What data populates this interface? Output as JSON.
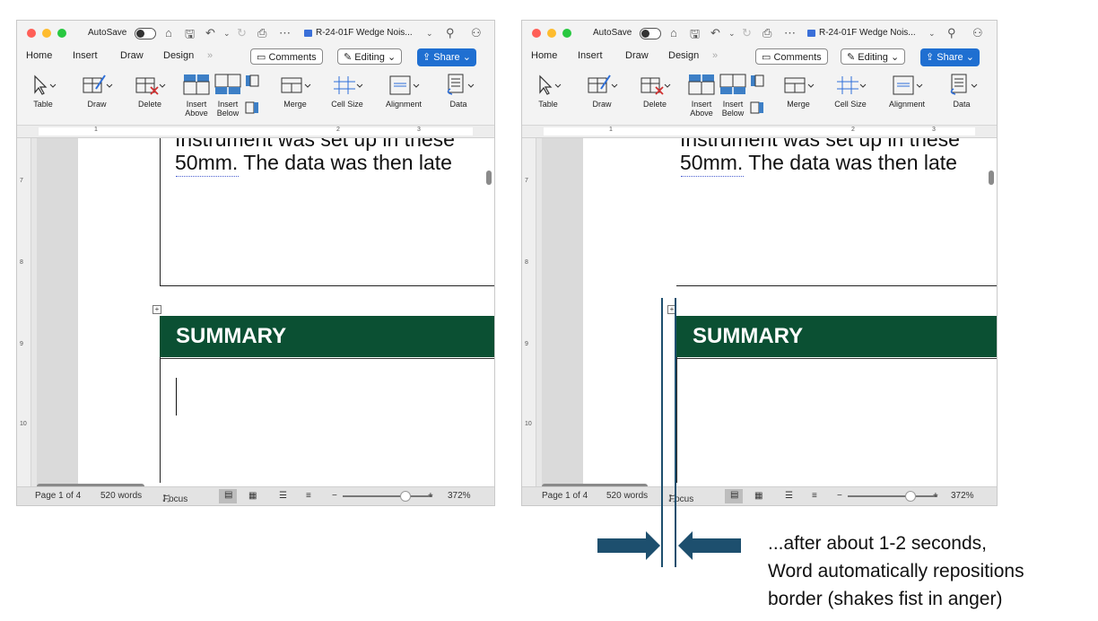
{
  "window": {
    "autosave_label": "AutoSave",
    "doc_title": "R-24-01F Wedge Nois...",
    "tabs": [
      "Home",
      "Insert",
      "Draw",
      "Design"
    ],
    "overflow": "»",
    "comments_label": "Comments",
    "editing_label": "Editing",
    "share_label": "Share",
    "ribbon": [
      "Table",
      "Draw",
      "Delete",
      "Insert Above",
      "Insert Below",
      "Merge",
      "Cell Size",
      "Alignment",
      "Data"
    ],
    "ribbon_insert_above": [
      "Insert",
      "Above"
    ],
    "ribbon_insert_below": [
      "Insert",
      "Below"
    ],
    "ruler_numbers": [
      "1",
      "2",
      "3"
    ],
    "vruler_numbers": [
      "7",
      "8",
      "9",
      "10"
    ]
  },
  "document": {
    "partial_line": "Instrument was set up in these",
    "line_prefix": "50mm",
    "line_rest": ". The data was then late",
    "summary_heading": "SUMMARY"
  },
  "status": {
    "page": "Page 1 of 4",
    "words": "520 words",
    "focus": "Focus",
    "zoom": "372%",
    "zoom_level_fraction": 0.7
  },
  "annotation": {
    "lines": [
      "...after about 1-2 seconds,",
      "Word automatically repositions",
      "border (shakes fist in anger)"
    ]
  },
  "colors": {
    "summary_bg": "#0b5033",
    "arrow": "#1d4f6e",
    "share_bg": "#1f6fd1"
  },
  "icons": [
    "close-dot",
    "minimize-dot",
    "zoom-dot",
    "home-icon",
    "save-icon",
    "undo-icon",
    "redo-icon",
    "print-icon",
    "more-icon",
    "search-icon",
    "share-people-icon",
    "comment-icon",
    "pencil-icon",
    "share-icon",
    "chevron-down-icon",
    "table-select-icon",
    "draw-table-icon",
    "delete-table-icon",
    "insert-above-icon",
    "insert-below-icon",
    "insert-left-icon",
    "insert-right-icon",
    "merge-icon",
    "cell-size-icon",
    "alignment-icon",
    "data-icon",
    "focus-icon",
    "arrow-right-icon",
    "arrow-left-icon"
  ]
}
